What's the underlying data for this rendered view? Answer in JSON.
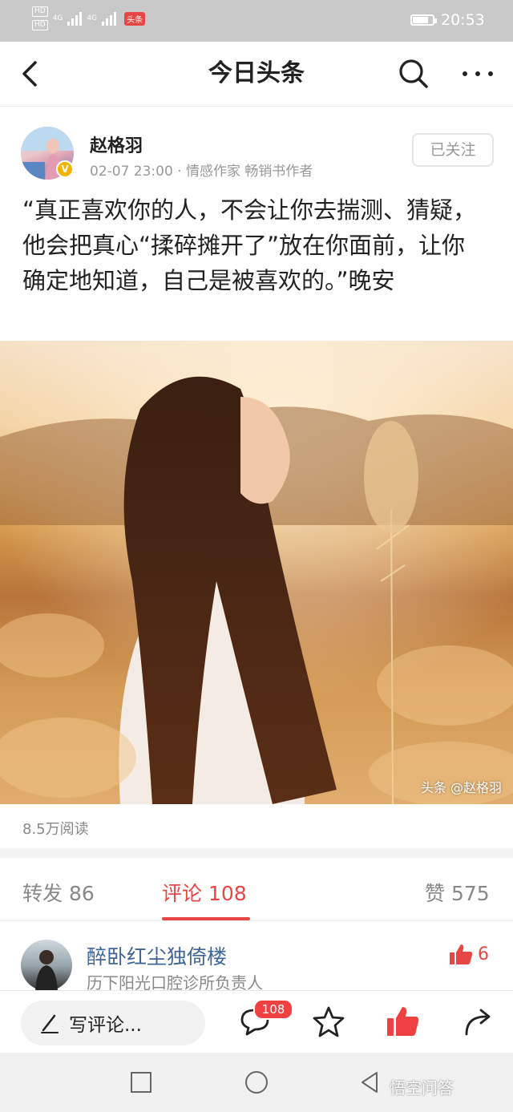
{
  "status_bar": {
    "hd_label": "HD",
    "net_label": "4G",
    "app_badge": "头条",
    "time": "20:53",
    "battery_level": 0.8
  },
  "nav": {
    "title": "今日头条",
    "back_icon": "chevron-left-icon",
    "search_icon": "search-icon",
    "more_icon": "more-horizontal-icon"
  },
  "post": {
    "author": {
      "name": "赵格羽",
      "meta": "02-07 23:00 · 情感作家 畅销书作者",
      "verified_mark": "V"
    },
    "follow_label": "已关注",
    "text": "“真正喜欢你的人，不会让你去揣测、猜疑，他会把真心“揉碎摊开了”放在你面前，让你确定地知道，自己是被喜欢的。”晚安",
    "image_watermark": "头条 @赵格羽",
    "read_count": "8.5万阅读"
  },
  "tabs": {
    "forward": "转发 86",
    "comments": "评论 108",
    "likes": "赞 575"
  },
  "comment": {
    "name": "醉卧红尘独倚楼",
    "subtitle": "历下阳光口腔诊所负责人",
    "likes": "6"
  },
  "action_bar": {
    "write_placeholder": "写评论...",
    "comment_count": "108",
    "icons": [
      "pencil-icon",
      "comment-icon",
      "star-icon",
      "thumbs-up-icon",
      "share-icon"
    ]
  },
  "system_nav": {
    "watermark": "悟空问答"
  },
  "colors": {
    "accent": "#e84545",
    "link_blue": "#406599",
    "status_bar_bg": "#c9c9c9"
  }
}
